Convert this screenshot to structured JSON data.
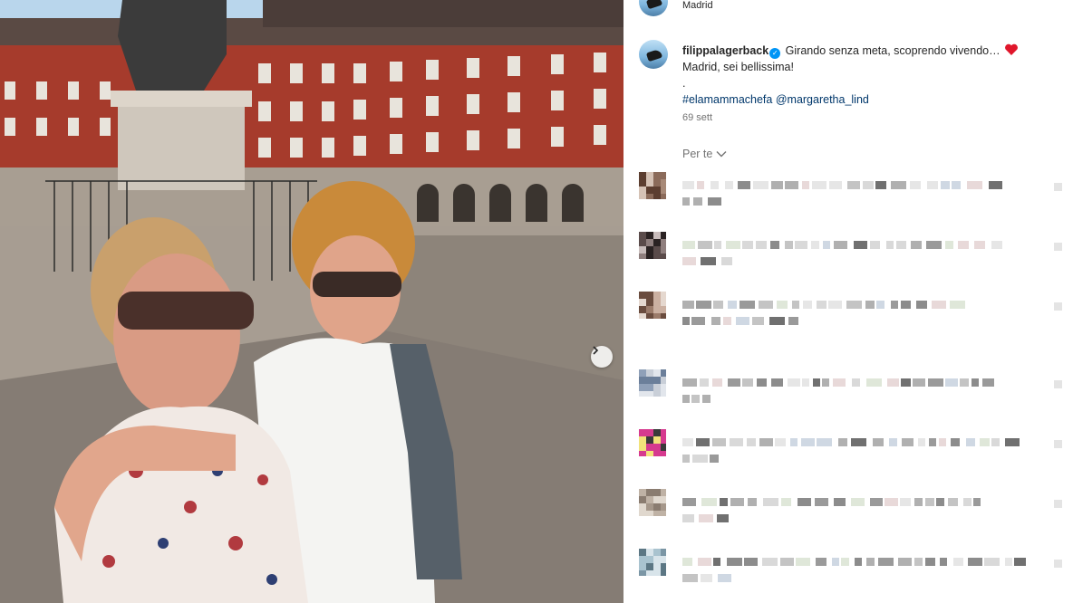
{
  "post": {
    "location_user_location": "Madrid",
    "username": "filippalagerback",
    "caption_line1": "Girando senza meta, scoprendo vivendo…",
    "caption_line2": "Madrid, sei bellissima!",
    "caption_dot": ".",
    "hashtag": "#elamammachefa",
    "mention": "@margaretha_lind",
    "time_ago": "69 sett"
  },
  "comments": {
    "filter_label": "Per te",
    "count_visible": 7
  },
  "icons": {
    "verified": "verified-badge-icon",
    "heart": "red-heart-icon",
    "next": "chevron-right-icon",
    "filter": "chevron-down-icon"
  },
  "colors": {
    "link": "#00376b",
    "verified": "#0095f6",
    "heart": "#e0162b",
    "muted": "#737373"
  }
}
